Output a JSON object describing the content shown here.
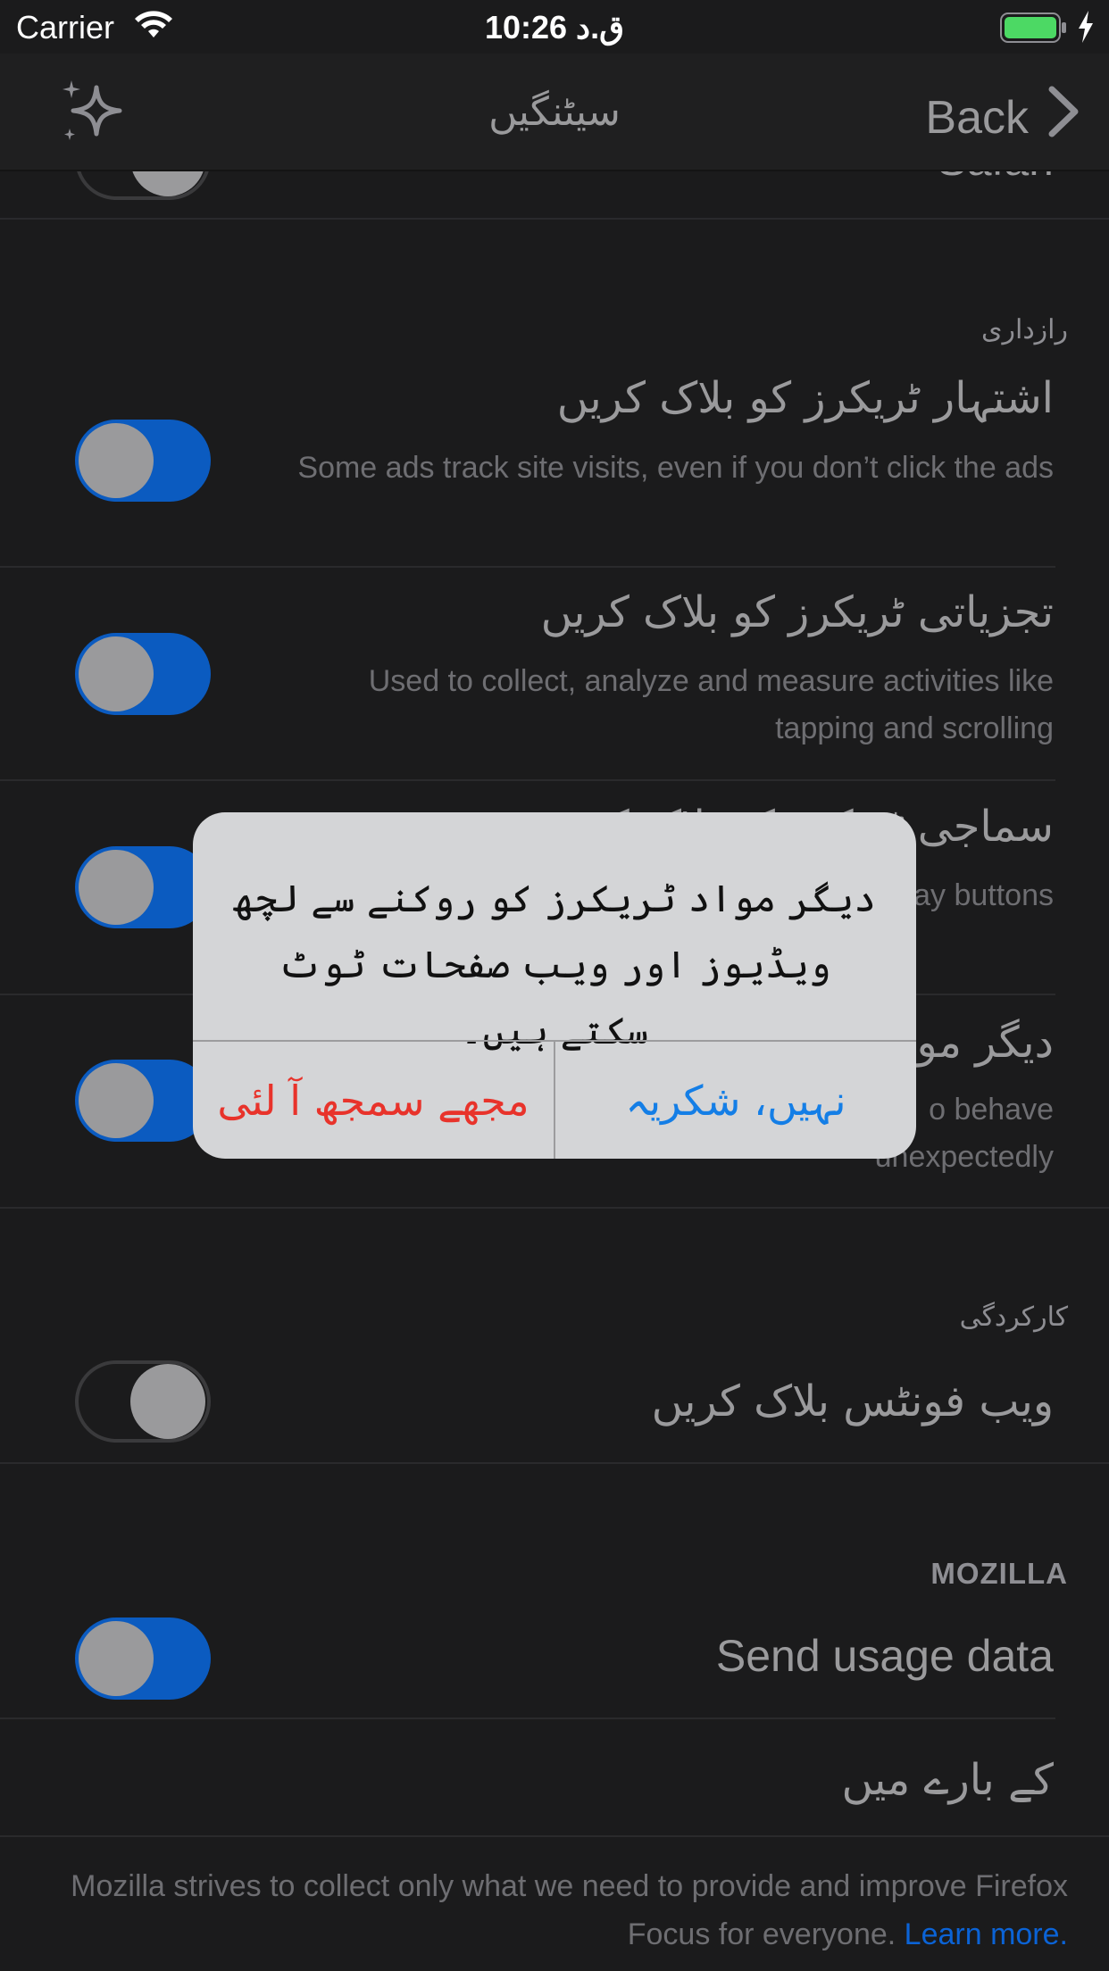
{
  "status_bar": {
    "carrier": "Carrier",
    "time": "10:26 ق.د",
    "icons": [
      "wifi-icon",
      "battery-icon",
      "charging-icon"
    ]
  },
  "nav": {
    "title": "سیٹنگیں",
    "back_label": "Back",
    "left_icon": "sparkle-icon"
  },
  "previous_row": {
    "title": "Safari"
  },
  "privacy": {
    "header": "رازداری",
    "rows": [
      {
        "title": "اشتہار ٹریکرز کو بلاک کریں",
        "subtitle": "Some ads track site visits, even if you don’t click the ads",
        "enabled": true
      },
      {
        "title": "تجزیاتی ٹریکرز کو بلاک کریں",
        "subtitle": "Used to collect, analyze and measure activities like tapping and scrolling",
        "enabled": true
      },
      {
        "title": "سماجی ٹریکرز کو بلاک کریں",
        "subtitle": "to display buttons",
        "enabled": true
      },
      {
        "title": "دیگر مواد ٹریکرز کو بلاک کریں",
        "subtitle": "o behave unexpectedly",
        "enabled": true
      }
    ]
  },
  "performance": {
    "header": "کارکردگی",
    "rows": [
      {
        "title": "ویب فونٹس بلاک کریں",
        "enabled": false
      }
    ]
  },
  "mozilla": {
    "header": "MOZILLA",
    "send_usage": {
      "title": "Send usage data",
      "enabled": true
    },
    "about": {
      "title": "کے بارے میں"
    },
    "footer": "Mozilla strives to collect only what we need to provide and improve Firefox Focus for everyone.",
    "learn_more": "Learn more."
  },
  "alert": {
    "message": "دیگر مواد ٹریکرز کو روکنے سے لچھ ویڈیوز اور ویب صفحات ٹوٹ سکتے ہیں۔",
    "destructive_label": "مجھے سمجھ آ لئی",
    "cancel_label": "نہیں، شکریہ"
  },
  "colors": {
    "toggle_on": "#0b5bc0",
    "accent_link": "#0b63d6",
    "destructive": "#e8332b",
    "cancel": "#147ee6"
  }
}
